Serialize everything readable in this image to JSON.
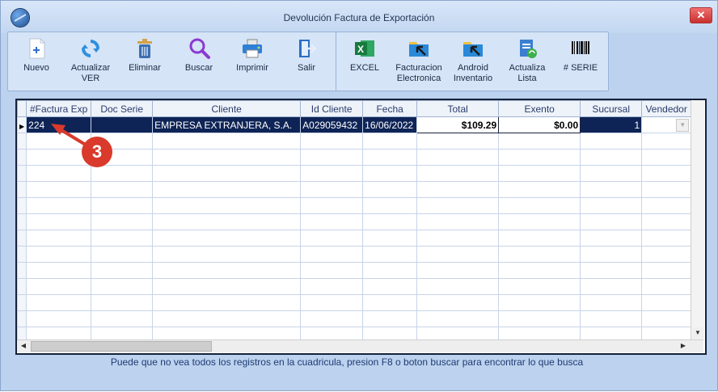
{
  "window": {
    "title": "Devolución  Factura de  Exportación"
  },
  "toolbar_left": [
    {
      "label": "Nuevo",
      "icon": "new-document-icon"
    },
    {
      "label": "Actualizar VER",
      "icon": "refresh-icon"
    },
    {
      "label": "Eliminar",
      "icon": "trash-icon"
    },
    {
      "label": "Buscar",
      "icon": "search-icon"
    },
    {
      "label": "Imprimir",
      "icon": "printer-icon"
    },
    {
      "label": "Salir",
      "icon": "exit-icon"
    }
  ],
  "toolbar_right": [
    {
      "label": "EXCEL",
      "icon": "excel-icon"
    },
    {
      "label": "Facturacion Electronica",
      "icon": "folder-arrow-icon"
    },
    {
      "label": "Android Inventario",
      "icon": "folder-arrow-icon"
    },
    {
      "label": "Actualiza Lista",
      "icon": "update-list-icon"
    },
    {
      "label": "# SERIE",
      "icon": "barcode-icon"
    }
  ],
  "grid": {
    "columns": [
      "#Factura Exp",
      "Doc Serie",
      "Cliente",
      "Id Cliente",
      "Fecha",
      "Total",
      "Exento",
      "Sucursal",
      "Vendedor"
    ],
    "rows": [
      {
        "factura": "224",
        "doc_serie": "",
        "cliente": "EMPRESA EXTRANJERA, S.A.",
        "id_cliente": "A029059432",
        "fecha": "16/06/2022",
        "total": "$109.29",
        "exento": "$0.00",
        "sucursal": "1",
        "vendedor": ""
      }
    ]
  },
  "annotation": {
    "badge": "3"
  },
  "footer": {
    "hint": "Puede que no vea todos los registros en la cuadricula, presion F8 o boton buscar para encontrar lo que busca"
  },
  "colors": {
    "accent": "#0f2456",
    "window_bg": "#bcd2ee",
    "badge": "#d93a2b"
  }
}
